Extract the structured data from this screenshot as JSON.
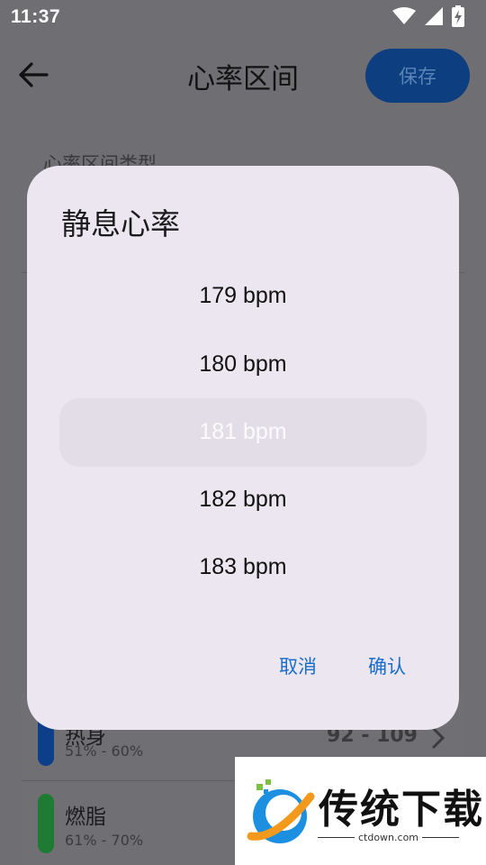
{
  "status_bar": {
    "time": "11:37",
    "icons": [
      "wifi-icon",
      "signal-icon",
      "battery-charging-icon"
    ]
  },
  "app_bar": {
    "back_icon": "arrow-back-icon",
    "title": "心率区间",
    "save_label": "保存"
  },
  "background": {
    "section_label": "心率区间类型",
    "zones": [
      {
        "name": "热身",
        "percent": "51% - 60%",
        "range": "92 - 109",
        "color": "#0d3e8a"
      },
      {
        "name": "燃脂",
        "percent": "61% - 70%",
        "range": "",
        "color": "#1e7b34"
      }
    ]
  },
  "dialog": {
    "title": "静息心率",
    "picker_items": [
      "179 bpm",
      "180 bpm",
      "181 bpm",
      "182 bpm",
      "183 bpm"
    ],
    "selected_index": 2,
    "cancel_label": "取消",
    "confirm_label": "确认"
  },
  "watermark": {
    "brand": "传统下载",
    "url": "ctdown.com"
  }
}
